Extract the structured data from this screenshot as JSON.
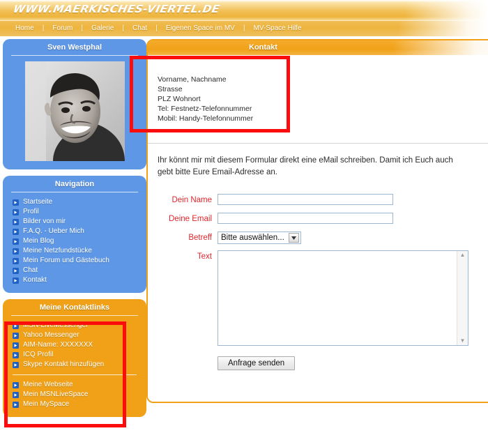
{
  "site": {
    "logo": "WWW.MAERKISCHES-VIERTEL.DE"
  },
  "nav": {
    "separator": "|",
    "items": [
      {
        "label": "Home"
      },
      {
        "label": "Forum"
      },
      {
        "label": "Galerie"
      },
      {
        "label": "Chat"
      },
      {
        "label": "Eigenen Space im MV"
      },
      {
        "label": "MV-Space Hilfe"
      }
    ]
  },
  "profile_panel": {
    "title": "Sven Westphal",
    "photo_alt": "profile-photo"
  },
  "navigation_panel": {
    "title": "Navigation",
    "items": [
      {
        "label": "Startseite",
        "icon": "arrow-right-square-icon"
      },
      {
        "label": "Profil",
        "icon": "arrow-right-square-icon"
      },
      {
        "label": "Bilder von mir",
        "icon": "arrow-right-square-icon"
      },
      {
        "label": "F.A.Q. - Ueber Mich",
        "icon": "arrow-right-square-icon"
      },
      {
        "label": "Mein Blog",
        "icon": "arrow-right-square-icon"
      },
      {
        "label": "Meine Netzfundstücke",
        "icon": "arrow-right-square-icon"
      },
      {
        "label": "Mein Forum und Gästebuch",
        "icon": "arrow-right-square-icon"
      },
      {
        "label": "Chat",
        "icon": "arrow-right-square-icon"
      },
      {
        "label": "Kontakt",
        "icon": "arrow-right-square-icon"
      }
    ]
  },
  "kontaktlinks_panel": {
    "title": "Meine Kontaktlinks",
    "group_one": [
      {
        "label": "MSN-LiveMessenger",
        "icon": "arrow-right-square-icon"
      },
      {
        "label": "Yahoo Messenger",
        "icon": "arrow-right-square-icon"
      },
      {
        "label": "AIM-Name: XXXXXXX",
        "icon": "arrow-right-square-icon"
      },
      {
        "label": "ICQ Profil",
        "icon": "arrow-right-square-icon"
      },
      {
        "label": "Skype Kontakt hinzufügen",
        "icon": "arrow-right-square-icon"
      }
    ],
    "group_two": [
      {
        "label": "Meine Webseite",
        "icon": "arrow-right-square-icon"
      },
      {
        "label": "Mein MSNLiveSpace",
        "icon": "arrow-right-square-icon"
      },
      {
        "label": "Mein MySpace",
        "icon": "arrow-right-square-icon"
      }
    ]
  },
  "content": {
    "title": "Kontakt",
    "vcard": {
      "line1": "Vorname, Nachname",
      "line2": "Strasse",
      "line3": "PLZ Wohnort",
      "line4": "Tel: Festnetz-Telefonnummer",
      "line5": "Mobil: Handy-Telefonnummer"
    },
    "intro": "Ihr könnt mir mit diesem Formular direkt eine eMail schreiben. Damit ich Euch auch\ngebt bitte Eure Email-Adresse an.",
    "form": {
      "name_label": "Dein Name",
      "name_value": "",
      "email_label": "Deine Email",
      "email_value": "",
      "subject_label": "Betreff",
      "subject_selected": "Bitte auswählen...",
      "text_label": "Text",
      "text_value": "",
      "submit_label": "Anfrage senden"
    }
  },
  "annotations": {
    "vcard_highlight": "red-box-contact-details",
    "links_highlight": "red-box-kontaktlinks",
    "color": "#fc0d0d"
  }
}
